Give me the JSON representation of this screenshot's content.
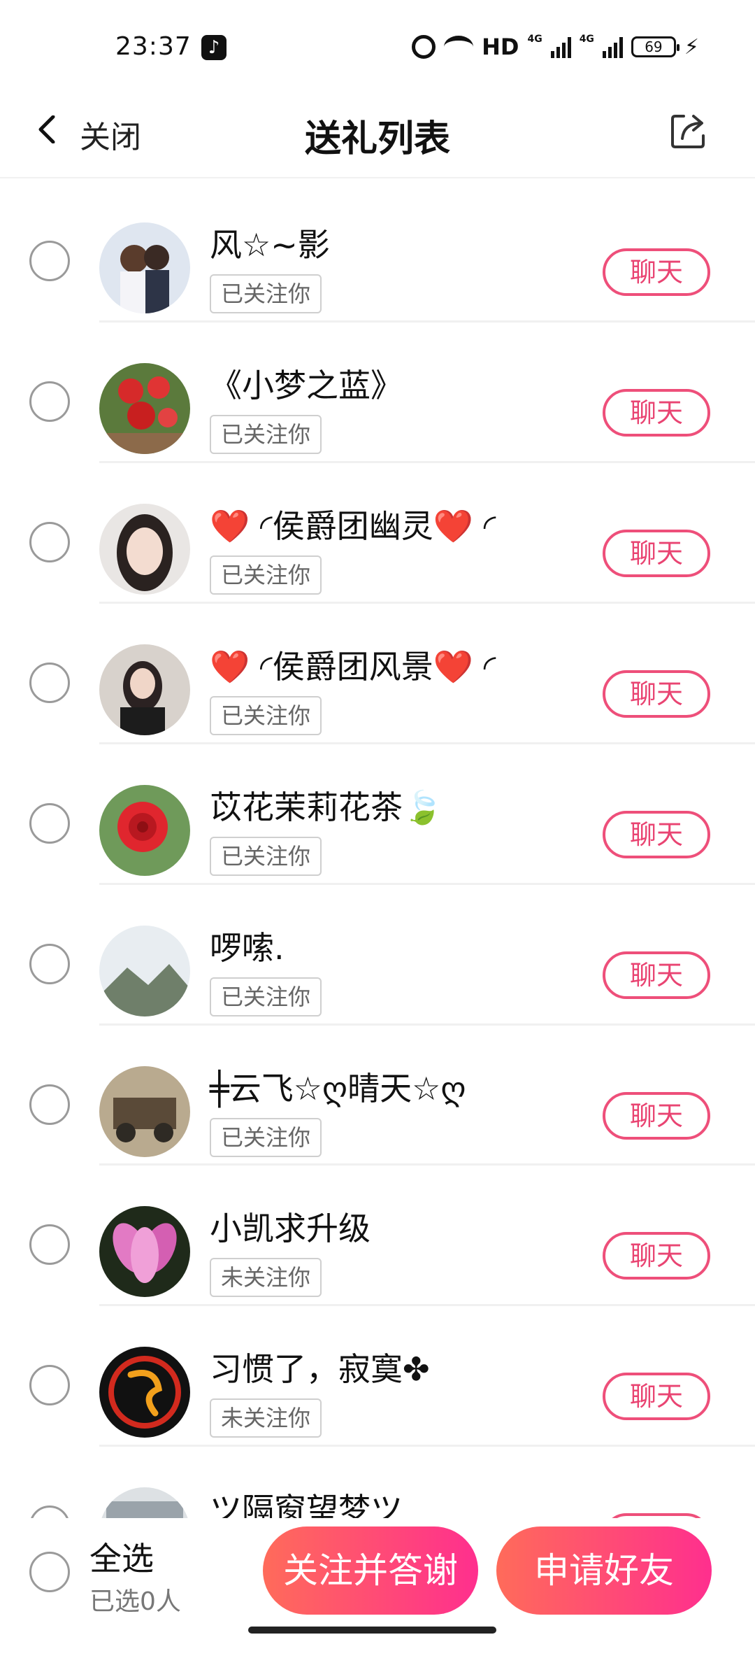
{
  "status_bar": {
    "time": "23:37",
    "network": "HD",
    "network_type": "4G",
    "battery": "69"
  },
  "header": {
    "close_label": "关闭",
    "title": "送礼列表"
  },
  "list": {
    "chat_label": "聊天",
    "items": [
      {
        "name": "风☆~影",
        "follow_status": "已关注你"
      },
      {
        "name": "《小梦之蓝》",
        "follow_status": "已关注你"
      },
      {
        "name": "❤️ ◜侯爵团幽灵❤️ ◜",
        "follow_status": "已关注你"
      },
      {
        "name": "❤️ ◜侯爵团风景❤️ ◜",
        "follow_status": "已关注你"
      },
      {
        "name": "苡花茉莉花茶🍃",
        "follow_status": "已关注你"
      },
      {
        "name": "啰嗦.",
        "follow_status": "已关注你"
      },
      {
        "name": "╪云飞☆ღ晴天☆ღ",
        "follow_status": "已关注你"
      },
      {
        "name": "小凯求升级",
        "follow_status": "未关注你"
      },
      {
        "name": "习惯了，寂寞✤",
        "follow_status": "未关注你"
      },
      {
        "name": "ツ隔窗望梦ツ",
        "follow_status": ""
      }
    ]
  },
  "bottom_bar": {
    "select_all_label": "全选",
    "selected_count": "已选0人",
    "follow_thanks_button": "关注并答谢",
    "add_friend_button": "申请好友"
  },
  "colors": {
    "accent": "#ee4f7a",
    "button_gradient_start": "#ff6b5a",
    "button_gradient_end": "#ff2f8e"
  }
}
